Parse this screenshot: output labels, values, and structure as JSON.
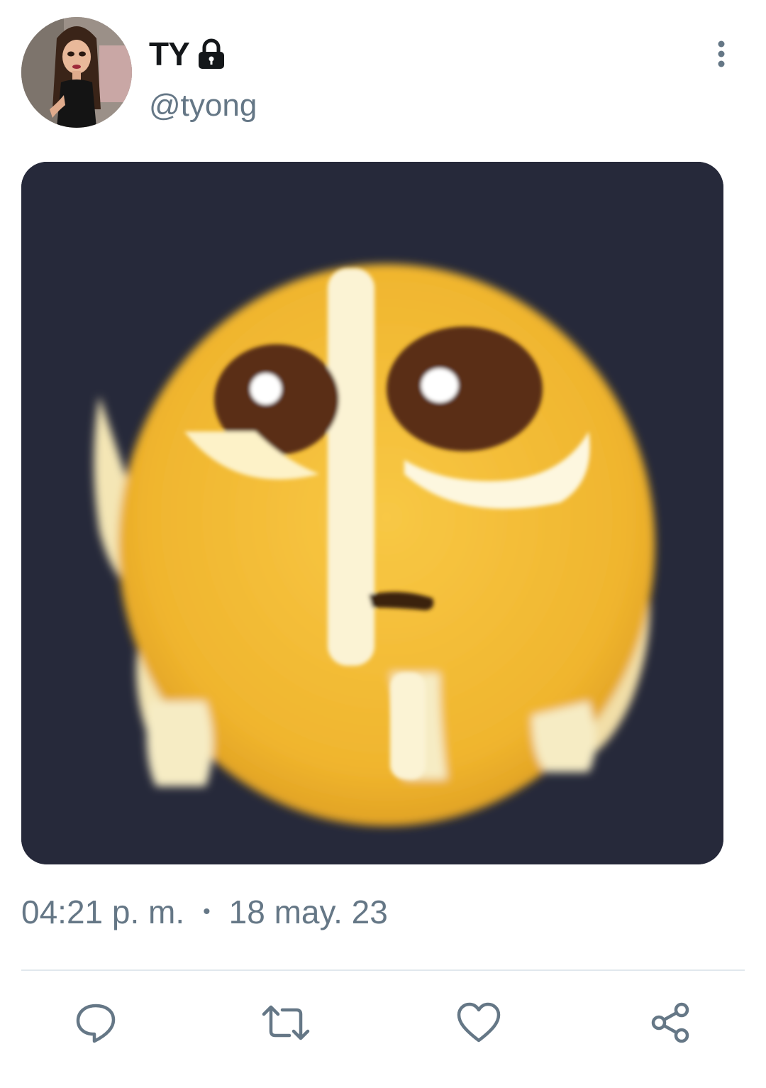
{
  "tweet": {
    "author": {
      "display_name": "TY",
      "handle": "@tyong",
      "protected_icon": "lock-icon"
    },
    "menu_icon": "more-vertical-icon",
    "media": {
      "icon": "pleading-face-emoji"
    },
    "time": "04:21 p. m.",
    "separator": "•",
    "date": "18 may. 23",
    "actions": [
      {
        "icon": "reply-icon"
      },
      {
        "icon": "retweet-icon"
      },
      {
        "icon": "like-icon"
      },
      {
        "icon": "share-icon"
      }
    ]
  },
  "colors": {
    "text_primary": "#14171a",
    "text_secondary": "#657786",
    "divider": "#e1e8ed",
    "media_background": "#26293a",
    "emoji_yellow": "#f2b731"
  }
}
